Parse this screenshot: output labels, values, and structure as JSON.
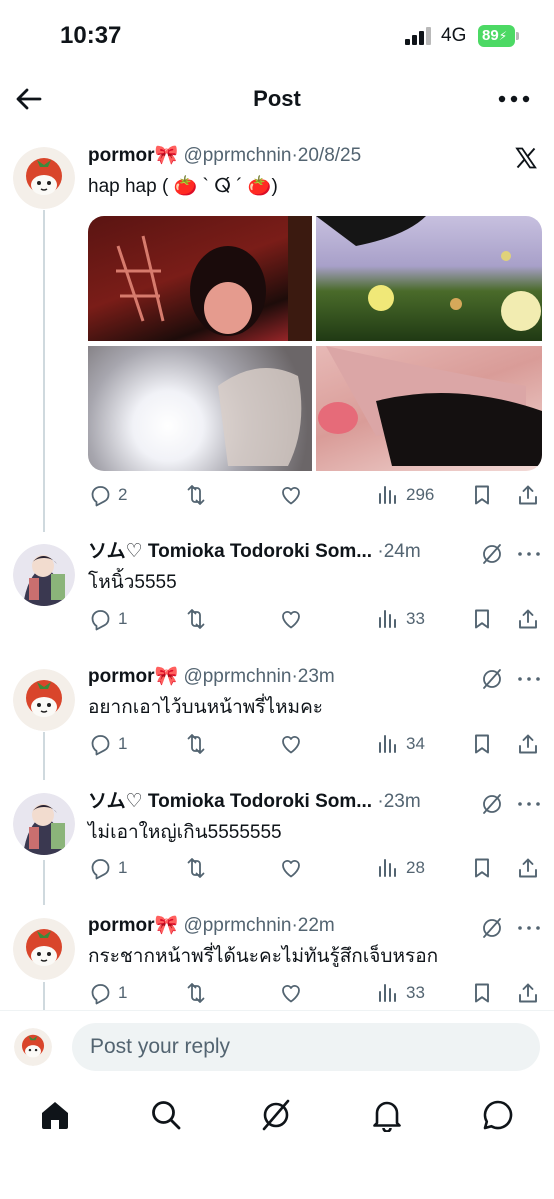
{
  "status_bar": {
    "time": "10:37",
    "network": "4G",
    "battery": "89"
  },
  "header": {
    "title": "Post"
  },
  "main_post": {
    "name": "pormor🎀",
    "handle": "@pprmchnin",
    "sep": "·",
    "date": "20/8/25",
    "text": "hap hap ( 🍅 ` ⵕ́ ´ 🍅)",
    "replies": "2",
    "views": "296"
  },
  "replies": [
    {
      "name": "ソム♡ Tomioka Todoroki Som...",
      "handle": "",
      "sep": "·",
      "time": "24m",
      "text": "โหนิ้ว5555",
      "replies": "1",
      "views": "33"
    },
    {
      "name": "pormor🎀",
      "handle": "@pprmchnin",
      "sep": "·",
      "time": "23m",
      "text": "อยากเอาไว้บนหน้าพรี่ไหมคะ",
      "replies": "1",
      "views": "34"
    },
    {
      "name": "ソム♡ Tomioka Todoroki Som...",
      "handle": "",
      "sep": "·",
      "time": "23m",
      "text": "ไม่เอาใหญ่เกิน5555555",
      "replies": "1",
      "views": "28"
    },
    {
      "name": "pormor🎀",
      "handle": "@pprmchnin",
      "sep": "·",
      "time": "22m",
      "text": "กระชากหน้าพรี่ได้นะคะไม่ทันรู้สึกเจ็บหรอก",
      "replies": "1",
      "views": "33"
    }
  ],
  "reply_box": {
    "placeholder": "Post your reply"
  },
  "icons": {
    "back": "arrow-left-icon",
    "more": "more-dots-icon",
    "x_logo": "x-logo-icon",
    "reply": "reply-icon",
    "repost": "repost-icon",
    "like": "heart-icon",
    "views": "views-icon",
    "bookmark": "bookmark-icon",
    "share": "share-icon",
    "grok": "grok-icon",
    "home": "home-icon",
    "search": "search-icon",
    "notifications": "bell-icon",
    "messages": "messages-icon"
  },
  "colors": {
    "battery": "#4cd964",
    "muted": "#536471",
    "thread_line": "#cfd9de",
    "input_bg": "#eff3f4"
  }
}
